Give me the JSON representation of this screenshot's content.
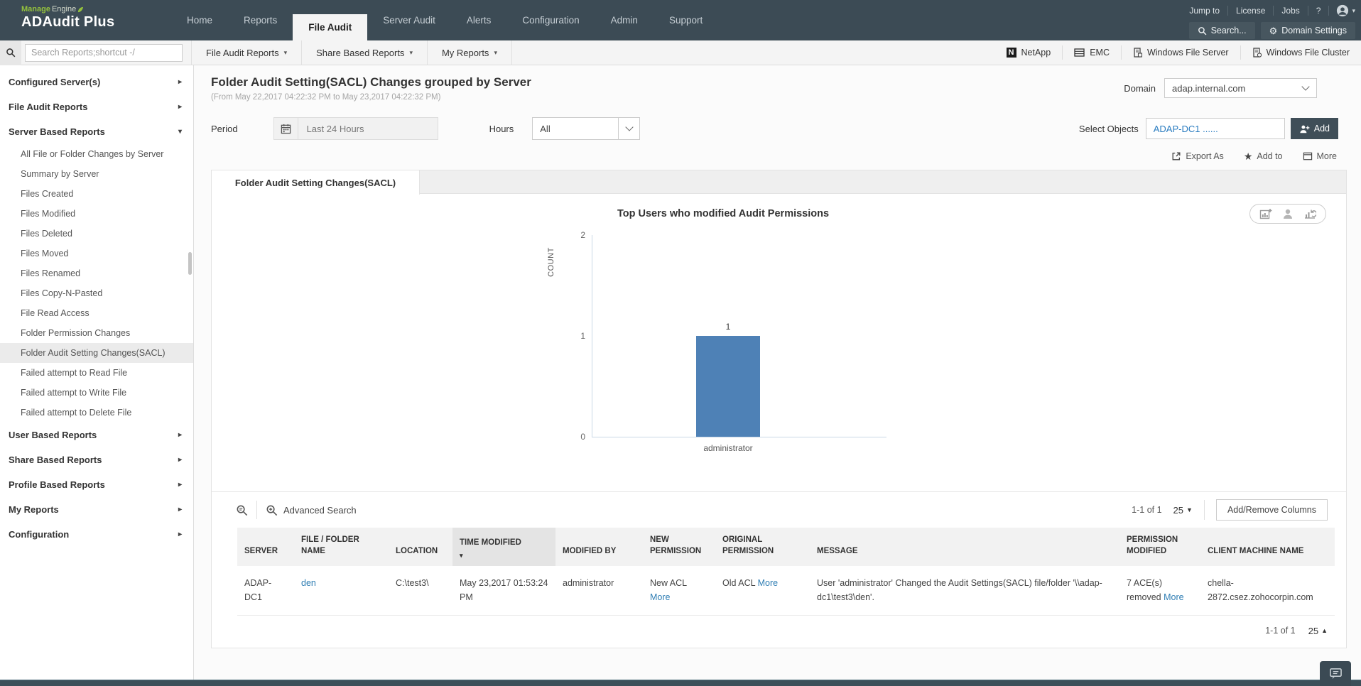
{
  "brand": {
    "manage": "Manage",
    "engine": "Engine",
    "product": "ADAudit Plus"
  },
  "header": {
    "nav": [
      {
        "label": "Home"
      },
      {
        "label": "Reports"
      },
      {
        "label": "File Audit",
        "cls": "active"
      },
      {
        "label": "Server Audit"
      },
      {
        "label": "Alerts"
      },
      {
        "label": "Configuration"
      },
      {
        "label": "Admin"
      },
      {
        "label": "Support"
      }
    ],
    "links": [
      "Jump to",
      "License",
      "Jobs",
      "?"
    ],
    "search_button": "Search...",
    "domain_settings": "Domain Settings"
  },
  "subbar": {
    "search_placeholder": "Search Reports;shortcut -/",
    "menus": [
      "File Audit Reports",
      "Share Based Reports",
      "My Reports"
    ],
    "platforms": [
      "NetApp",
      "EMC",
      "Windows File Server",
      "Windows File Cluster"
    ]
  },
  "sidebar": {
    "items": [
      {
        "label": "Configured Server(s)",
        "cls": "section",
        "arrow": "▸"
      },
      {
        "label": "File Audit Reports",
        "cls": "section",
        "arrow": "▸"
      },
      {
        "label": "Server Based Reports",
        "cls": "section",
        "arrow": "▾"
      },
      {
        "label": "All File or Folder Changes by Server",
        "cls": "sub"
      },
      {
        "label": "Summary by Server",
        "cls": "sub"
      },
      {
        "label": "Files Created",
        "cls": "sub"
      },
      {
        "label": "Files Modified",
        "cls": "sub"
      },
      {
        "label": "Files Deleted",
        "cls": "sub"
      },
      {
        "label": "Files Moved",
        "cls": "sub"
      },
      {
        "label": "Files Renamed",
        "cls": "sub"
      },
      {
        "label": "Files Copy-N-Pasted",
        "cls": "sub"
      },
      {
        "label": "File Read Access",
        "cls": "sub"
      },
      {
        "label": "Folder Permission Changes",
        "cls": "sub"
      },
      {
        "label": "Folder Audit Setting Changes(SACL)",
        "cls": "sub selected"
      },
      {
        "label": "Failed attempt to Read File",
        "cls": "sub"
      },
      {
        "label": "Failed attempt to Write File",
        "cls": "sub"
      },
      {
        "label": "Failed attempt to Delete File",
        "cls": "sub"
      },
      {
        "label": "User Based Reports",
        "cls": "section",
        "arrow": "▸"
      },
      {
        "label": "Share Based Reports",
        "cls": "section",
        "arrow": "▸"
      },
      {
        "label": "Profile Based Reports",
        "cls": "section",
        "arrow": "▸"
      },
      {
        "label": "My Reports",
        "cls": "section",
        "arrow": "▸"
      },
      {
        "label": "Configuration",
        "cls": "section",
        "arrow": "▸"
      }
    ]
  },
  "report": {
    "title": "Folder Audit Setting(SACL) Changes grouped by Server",
    "date_range": "(From May 22,2017 04:22:32 PM to May 23,2017 04:22:32 PM)",
    "domain_label": "Domain",
    "domain_value": "adap.internal.com",
    "period_label": "Period",
    "period_value": "Last 24 Hours",
    "hours_label": "Hours",
    "hours_value": "All",
    "select_objects_label": "Select Objects",
    "select_objects_value": "ADAP-DC1 ......",
    "add_button": "Add",
    "export_as": "Export As",
    "add_to": "Add to",
    "more": "More",
    "tab": "Folder Audit Setting Changes(SACL)"
  },
  "chart_data": {
    "type": "bar",
    "title": "Top Users who modified Audit Permissions",
    "categories": [
      "administrator"
    ],
    "values": [
      1
    ],
    "xlabel": "",
    "ylabel": "COUNT",
    "yticks": [
      0,
      1,
      2
    ],
    "ylim": [
      0,
      2
    ],
    "bar_color": "#4e81b6",
    "grid": false,
    "legend": false,
    "value_labels": true
  },
  "table": {
    "advanced_search": "Advanced Search",
    "range": "1-1 of 1",
    "page_size": "25",
    "add_remove_columns": "Add/Remove Columns",
    "columns": [
      {
        "label": "SERVER"
      },
      {
        "label": "FILE / FOLDER NAME"
      },
      {
        "label": "LOCATION"
      },
      {
        "label": "TIME MODIFIED",
        "cls": "sorted",
        "sort": "▾"
      },
      {
        "label": "MODIFIED BY"
      },
      {
        "label": "NEW PERMISSION"
      },
      {
        "label": "ORIGINAL PERMISSION"
      },
      {
        "label": "MESSAGE"
      },
      {
        "label": "PERMISSION MODIFIED"
      },
      {
        "label": "CLIENT MACHINE NAME"
      }
    ],
    "row": {
      "server": "ADAP-DC1",
      "file_folder_name": "den",
      "location": "C:\\test3\\",
      "time_modified": "May 23,2017 01:53:24 PM",
      "modified_by": "administrator",
      "new_permission": "New ACL",
      "new_permission_more": "More",
      "original_permission": "Old ACL",
      "original_permission_more": "More",
      "message": "User 'administrator' Changed the Audit Settings(SACL) file/folder '\\\\adap-dc1\\test3\\den'.",
      "permission_modified": "7 ACE(s) removed",
      "permission_modified_more": "More",
      "client_machine_name": "chella-2872.csez.zohocorpin.com"
    },
    "footer_range": "1-1 of 1",
    "footer_page_size": "25"
  }
}
